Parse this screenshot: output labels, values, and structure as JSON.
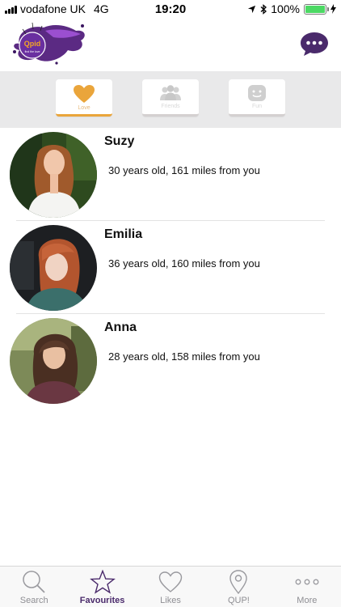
{
  "status_bar": {
    "carrier": "vodafone UK",
    "network": "4G",
    "time": "19:20",
    "battery": "100%",
    "battery_level": 1.0
  },
  "header": {
    "logo_text": "Qpid",
    "logo_subtext": "find the love",
    "chat_icon": "chat-bubble-icon"
  },
  "tabs": [
    {
      "label": "Love",
      "icon": "heart-icon",
      "active": true
    },
    {
      "label": "Friends",
      "icon": "people-icon",
      "active": false
    },
    {
      "label": "Fun",
      "icon": "smiley-icon",
      "active": false
    }
  ],
  "profiles": [
    {
      "name": "Suzy",
      "details": "30 years old, 161 miles from you"
    },
    {
      "name": "Emilia",
      "details": "36 years old, 160 miles from you"
    },
    {
      "name": "Anna",
      "details": "28 years old, 158 miles from you"
    }
  ],
  "tabbar": [
    {
      "label": "Search",
      "icon": "search-icon",
      "active": false
    },
    {
      "label": "Favourites",
      "icon": "star-icon",
      "active": true
    },
    {
      "label": "Likes",
      "icon": "heart-outline-icon",
      "active": false
    },
    {
      "label": "QUP!",
      "icon": "location-pin-icon",
      "active": false
    },
    {
      "label": "More",
      "icon": "more-dots-icon",
      "active": false
    }
  ],
  "colors": {
    "accent_purple": "#4a2a6b",
    "love_orange": "#eaa53b",
    "tab_area_bg": "#e9e9ea",
    "battery_green": "#4cd964"
  }
}
